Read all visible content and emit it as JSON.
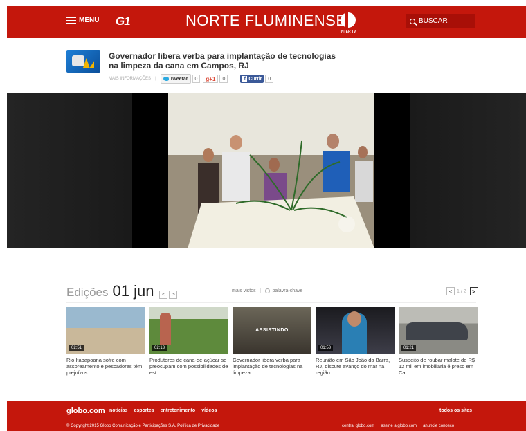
{
  "header": {
    "menu_label": "MENU",
    "g1_label": "G1",
    "site_title": "NORTE FLUMINENSE",
    "affiliate_label": "INTER TV",
    "search_label": "BUSCAR"
  },
  "article": {
    "headline": "Governador libera verba para implantação de tecnologias na limpeza da cana em Campos, RJ",
    "more_info": "MAIS INFORMAÇÕES",
    "tweet_label": "Tweetar",
    "tweet_count": "0",
    "gplus_label": "g+1",
    "gplus_count": "0",
    "fb_label": "Curtir",
    "fb_count": "0"
  },
  "editions": {
    "word": "Edições",
    "date": "01 jun",
    "prev": "<",
    "next": ">",
    "most_viewed": "mais vistos",
    "keyword": "palavra-chave",
    "pager": "1 / 2"
  },
  "thumbnails": [
    {
      "duration": "02:51",
      "caption": "Rio Itabapoana sofre com assoreamento e pescadores têm prejuízos",
      "badge": ""
    },
    {
      "duration": "02:13",
      "caption": "Produtores de cana-de-açúcar se preocupam com possibilidades de est...",
      "badge": ""
    },
    {
      "duration": "",
      "caption": "Governador libera verba para implantação de tecnologias na limpeza ...",
      "badge": "ASSISTINDO"
    },
    {
      "duration": "01:53",
      "caption": "Reunião em São João da Barra, RJ, discute avanço do mar na região",
      "badge": ""
    },
    {
      "duration": "01:21",
      "caption": "Suspeito de roubar malote de R$ 12 mil em imobiliária é preso em Ca...",
      "badge": ""
    }
  ],
  "footer": {
    "logo": "globo.com",
    "nav": [
      "notícias",
      "esportes",
      "entretenimento",
      "vídeos"
    ],
    "all_sites": "todos os sites",
    "copyright": "© Copyright 2015 Globo Comunicação e Participações S.A. Política de Privacidade",
    "links": [
      "central globo.com",
      "assine a globo.com",
      "anuncie conosco"
    ]
  },
  "colors": {
    "brand_red": "#c4170c",
    "dark_red": "#a80f07"
  }
}
